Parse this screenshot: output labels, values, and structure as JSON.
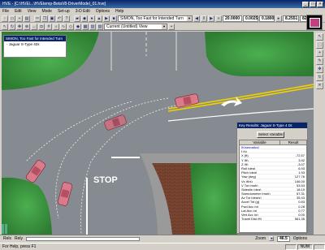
{
  "window": {
    "title": "HVE - [C:\\HVE\\...\\HVEtemp-BetaV8-DriverModel_01.hve]",
    "controls": [
      "_",
      "□",
      "×"
    ]
  },
  "menu": [
    "File",
    "Edit",
    "View",
    "Mode",
    "Set-up",
    "3-D Edit",
    "Options",
    "Help"
  ],
  "toolbar": {
    "event_select": "SIMON, Too Fast for Intended Turn",
    "view_select": "Current (Untitled) View",
    "time_fields": [
      "20.0000",
      "0.0025",
      "0.1800"
    ],
    "value_fields": [
      "8.2551",
      "82"
    ]
  },
  "scene": {
    "stop_text": "STOP"
  },
  "left_panel": {
    "title": "SIMON, Too Fast for Intended Turn",
    "item": "Jaguar S-Type 4Dr."
  },
  "results_panel": {
    "title": "Key Results: Jaguar S-Type 4 Dr.",
    "select_button": "Select Variable",
    "col_variable": "Variable",
    "col_result": "Result",
    "rows": [
      {
        "name": "[Kinematics]",
        "value": "",
        "cat": true
      },
      {
        "name": "t (s)",
        "value": "",
        "cat": false
      },
      {
        "name": "X (ft)",
        "value": "-72.57",
        "cat": false
      },
      {
        "name": "Y (ft)",
        "value": "3.92",
        "cat": false
      },
      {
        "name": "Z (ft)",
        "value": "-3.07",
        "cat": false
      },
      {
        "name": "Roll (deg)",
        "value": "6.93",
        "cat": false
      },
      {
        "name": "Pitch (deg)",
        "value": "1.93",
        "cat": false
      },
      {
        "name": "Yaw (deg)",
        "value": "127.76",
        "cat": false
      },
      {
        "name": "Vx (ft/s)",
        "value": "146.00",
        "cat": false
      },
      {
        "name": "V Tot (mph)",
        "value": "53.53",
        "cat": false
      },
      {
        "name": "Sideslip (deg)",
        "value": "18.19",
        "cat": false
      },
      {
        "name": "Speedometer (mph)",
        "value": "57.31",
        "cat": false
      },
      {
        "name": "Av Tot (deg/s)",
        "value": "35.43",
        "cat": false
      },
      {
        "name": "Accel Tot (g)",
        "value": "0.83",
        "cat": false
      },
      {
        "name": "Fwd Acc (g)",
        "value": "0.28",
        "cat": false
      },
      {
        "name": "Lat Acc (g)",
        "value": "0.77",
        "cat": false
      },
      {
        "name": "Vert Acc (g)",
        "value": "0.00",
        "cat": false
      },
      {
        "name": "Travel Dist (ft)",
        "value": "561.35",
        "cat": false
      }
    ]
  },
  "bottom": {
    "left1": "Relx",
    "left2": "Rely",
    "zoom_label": "Zoom",
    "zoom_value": "46.5",
    "options": "Options"
  },
  "status": {
    "text": "For Help, press F1",
    "num": "NUM"
  }
}
